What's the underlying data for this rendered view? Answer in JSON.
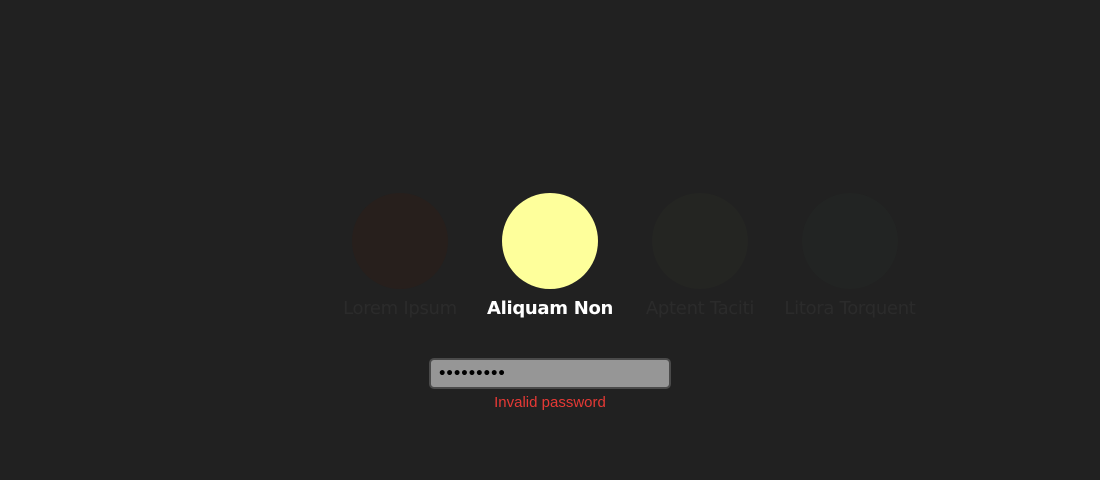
{
  "users": [
    {
      "name": "Lorem Ipsum",
      "avatar_color": "#271f1c",
      "active": false
    },
    {
      "name": "Aliquam Non",
      "avatar_color": "#feff9b",
      "active": true
    },
    {
      "name": "Aptent Taciti",
      "avatar_color": "#242522",
      "active": false
    },
    {
      "name": "Litora Torquent",
      "avatar_color": "#222423",
      "active": false
    }
  ],
  "login": {
    "password_masked": "•••••••••",
    "error_text": "Invalid password",
    "error_color": "#e53935"
  },
  "colors": {
    "background": "#212121",
    "input_background": "#969696"
  }
}
